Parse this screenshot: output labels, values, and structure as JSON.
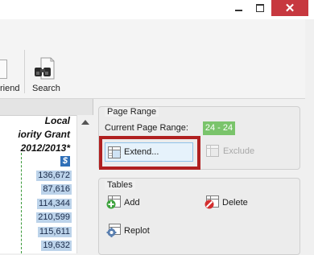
{
  "window": {
    "minimize_icon": "minimize-icon",
    "maximize_icon": "maximize-icon",
    "close_icon": "close-icon",
    "close_glyph": "✕",
    "close_color": "#c7383f"
  },
  "toolbar": {
    "friend_label": "riend",
    "search_label": "Search",
    "search_icon": "binoculars-icon"
  },
  "sheet": {
    "header_lines": [
      "Local",
      "iority Grant",
      "2012/2013*"
    ],
    "currency": "$",
    "values": [
      "136,672",
      "87,616",
      "114,344",
      "210,599",
      "115,611",
      "19,632",
      ""
    ]
  },
  "page_range": {
    "title": "Page Range",
    "current_label": "Current Page Range:",
    "current_value": "24 - 24",
    "badge_color": "#7ac46b",
    "extend_label": "Extend...",
    "exclude_label": "Exclude"
  },
  "tables": {
    "title": "Tables",
    "add_label": "Add",
    "delete_label": "Delete",
    "replot_label": "Replot"
  },
  "colors": {
    "highlight": "#b02020",
    "selection": "#bcd3ea",
    "accent_border": "#8ec2ea"
  }
}
